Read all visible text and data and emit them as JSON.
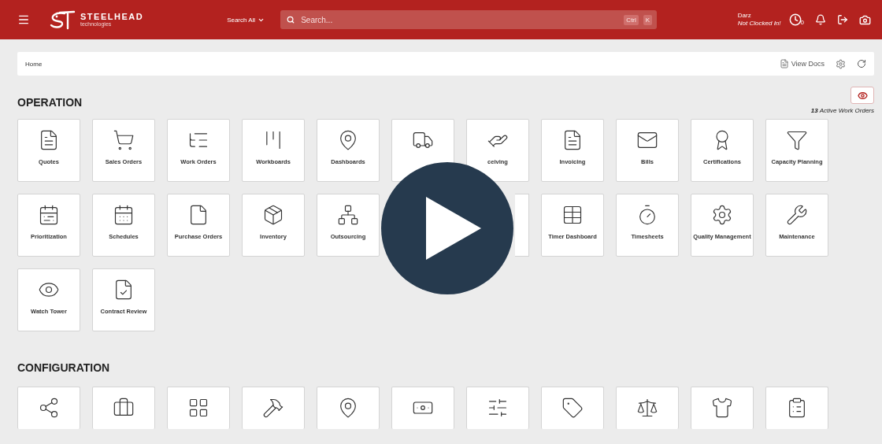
{
  "header": {
    "brand": "STEELHEAD",
    "brand_sub": "technologies",
    "search_scope": "Search All",
    "search": {
      "placeholder": "Search..."
    },
    "shortcut_keys": [
      "Ctrl",
      "K"
    ],
    "user": {
      "name": "Darz",
      "status": "Not Clocked In!"
    },
    "clock_badge": "0"
  },
  "breadcrumb": {
    "path": "Home",
    "docs_link": "View Docs"
  },
  "operation": {
    "title": "OPERATION",
    "active_orders": "**13** Active Work Orders",
    "tiles": [
      {
        "kind": "tile",
        "label": "Quotes"
      },
      {
        "kind": "tile",
        "label": "Sales Orders"
      },
      {
        "kind": "tile",
        "label": "Work Orders"
      },
      {
        "kind": "tile",
        "label": "Workboards"
      },
      {
        "kind": "tile",
        "label": "Dashboards"
      },
      {
        "kind": "tile"
      },
      {
        "kind": "tile",
        "label": "ceiving"
      },
      {
        "kind": "tile",
        "label": "Invoicing"
      },
      {
        "kind": "tile",
        "label": "Bills"
      },
      {
        "kind": "tile",
        "label": "Certifications"
      },
      {
        "kind": "tile",
        "label": "Capacity Planning"
      },
      {
        "kind": "tile",
        "label": "Prioritization"
      },
      {
        "kind": "tile",
        "label": "Schedules"
      },
      {
        "kind": "tile",
        "label": "Purchase Orders"
      },
      {
        "kind": "tile",
        "label": "Inventory"
      },
      {
        "kind": "tile",
        "label": "Outsourcing"
      },
      {
        "kind": "hidden"
      },
      {
        "kind": "edge"
      },
      {
        "kind": "tile",
        "label": "Timer Dashboard"
      },
      {
        "kind": "tile",
        "label": "Timesheets"
      },
      {
        "kind": "tile",
        "label": "Quality Management"
      },
      {
        "kind": "tile",
        "label": "Maintenance"
      },
      {
        "kind": "tile",
        "label": "Watch Tower"
      },
      {
        "kind": "tile",
        "label": "Contract Review"
      }
    ]
  },
  "configuration": {
    "title": "CONFIGURATION",
    "tiles": [
      {
        "kind": "tile"
      },
      {
        "kind": "tile"
      },
      {
        "kind": "tile"
      },
      {
        "kind": "tile"
      },
      {
        "kind": "tile"
      },
      {
        "kind": "tile"
      },
      {
        "kind": "tile"
      },
      {
        "kind": "tile"
      },
      {
        "kind": "tile"
      },
      {
        "kind": "tile"
      },
      {
        "kind": "tile"
      }
    ]
  },
  "video_overlay": {
    "play_button": true
  }
}
